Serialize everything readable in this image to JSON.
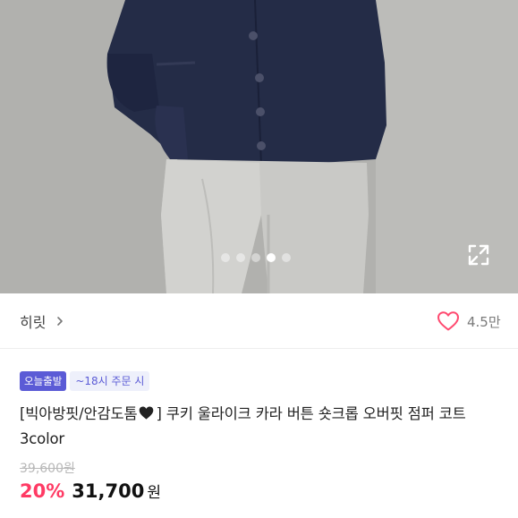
{
  "gallery": {
    "dot_count": 5,
    "active_index": 3,
    "expand_icon": "expand-arrows-icon"
  },
  "seller": {
    "name": "히릿",
    "chevron_icon": "chevron-right-icon"
  },
  "like": {
    "icon": "heart-outline-icon",
    "count": "4.5만",
    "color": "#ff4a70"
  },
  "badges": {
    "delivery": "오늘출발",
    "cutoff": "~18시 주문 시",
    "accent": "#5b5bd6"
  },
  "product": {
    "title_prefix": "[빅아방핏/안감도톰",
    "title_suffix": "] 쿠키 울라이크 카라 버튼 숏크롭 오버핏 점퍼 코트 3color",
    "original_price": "39,600원",
    "discount": "20%",
    "price": "31,700",
    "currency": "원",
    "discount_color": "#ff3a64"
  }
}
